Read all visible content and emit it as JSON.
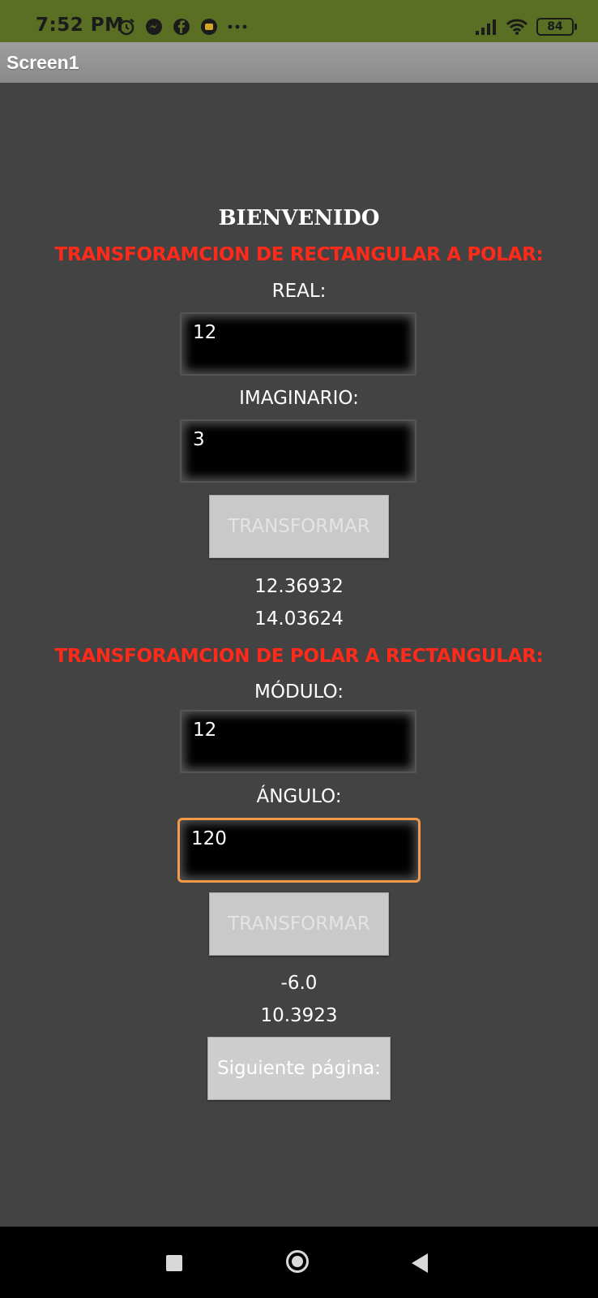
{
  "status_bar": {
    "time": "7:52 PM",
    "battery": "84",
    "left_icons": [
      "alarm-icon",
      "messenger-icon",
      "facebook-icon",
      "app-icon",
      "more-dots-icon"
    ],
    "right_icons": [
      "signal-icon",
      "wifi-icon",
      "battery-icon"
    ]
  },
  "app_bar": {
    "title": "Screen1"
  },
  "main": {
    "heading": "BIENVENIDO",
    "section1_title": "TRANSFORAMCION DE RECTANGULAR A POLAR:",
    "real_label": "REAL:",
    "real_value": "12",
    "imaginario_label": "IMAGINARIO:",
    "imaginario_value": "3",
    "transform_button_1": "TRANSFORMAR",
    "result_modulo": "12.36932",
    "result_angulo": "14.03624",
    "section2_title": "TRANSFORAMCION DE POLAR A RECTANGULAR:",
    "modulo_label": "MÓDULO:",
    "modulo_value": "12",
    "angulo_label": "ÁNGULO:",
    "angulo_value": "120",
    "transform_button_2": "TRANSFORMAR",
    "result_real": "-6.0",
    "result_imag": "10.3923",
    "next_button": "Siguiente página:"
  },
  "colors": {
    "status_bar": "#5a6e24",
    "background": "#434343",
    "section_title": "#ff2a1a",
    "focus_border": "#f29a49"
  },
  "nav_bar": {
    "icons": [
      "recents-square-icon",
      "home-circle-icon",
      "back-triangle-icon"
    ]
  }
}
